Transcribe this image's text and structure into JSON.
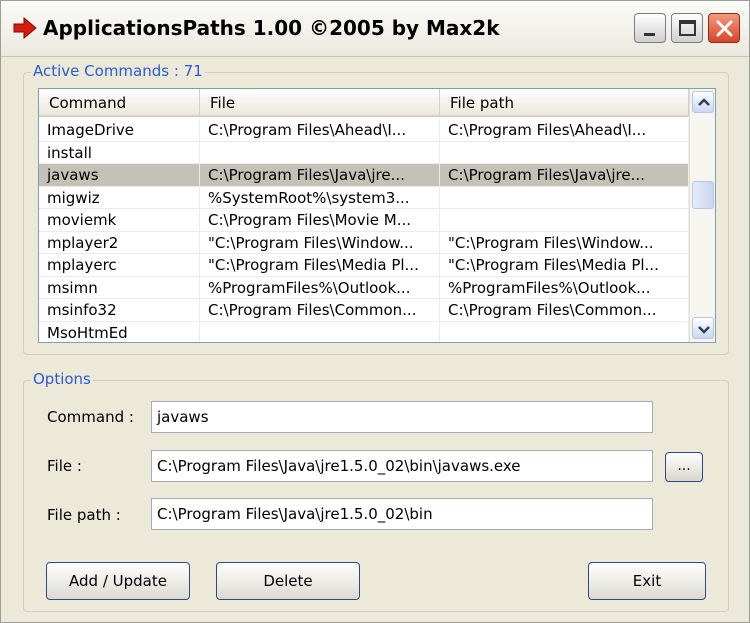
{
  "window": {
    "title": "ApplicationsPaths 1.00 ©2005 by Max2k",
    "icon": "red-arrow-icon"
  },
  "active_commands": {
    "legend": "Active Commands : 71",
    "columns": [
      "Command",
      "File",
      "File path"
    ],
    "rows": [
      {
        "command": "ImageDrive",
        "file": "C:\\Program Files\\Ahead\\I...",
        "path": "C:\\Program Files\\Ahead\\I..."
      },
      {
        "command": "install",
        "file": "",
        "path": ""
      },
      {
        "command": "javaws",
        "file": "C:\\Program Files\\Java\\jre...",
        "path": "C:\\Program Files\\Java\\jre...",
        "selected": true
      },
      {
        "command": "migwiz",
        "file": "%SystemRoot%\\system3...",
        "path": ""
      },
      {
        "command": "moviemk",
        "file": "C:\\Program Files\\Movie M...",
        "path": ""
      },
      {
        "command": "mplayer2",
        "file": "\"C:\\Program Files\\Window...",
        "path": "\"C:\\Program Files\\Window..."
      },
      {
        "command": "mplayerc",
        "file": "\"C:\\Program Files\\Media Pl...",
        "path": "\"C:\\Program Files\\Media Pl..."
      },
      {
        "command": "msimn",
        "file": "%ProgramFiles%\\Outlook...",
        "path": "%ProgramFiles%\\Outlook..."
      },
      {
        "command": "msinfo32",
        "file": "C:\\Program Files\\Common...",
        "path": "C:\\Program Files\\Common..."
      },
      {
        "command": "MsoHtmEd",
        "file": "",
        "path": ""
      }
    ]
  },
  "options": {
    "legend": "Options",
    "command_label": "Command :",
    "command_value": "javaws",
    "file_label": "File :",
    "file_value": "C:\\Program Files\\Java\\jre1.5.0_02\\bin\\javaws.exe",
    "file_path_label": "File path :",
    "file_path_value": "C:\\Program Files\\Java\\jre1.5.0_02\\bin",
    "browse_label": "..."
  },
  "buttons": {
    "add_update": "Add / Update",
    "delete": "Delete",
    "exit": "Exit"
  },
  "colors": {
    "legend_text": "#2a5bd7",
    "selected_row": "#c4c2b8",
    "close_button": "#d8442a",
    "title_icon": "#d81b10"
  }
}
